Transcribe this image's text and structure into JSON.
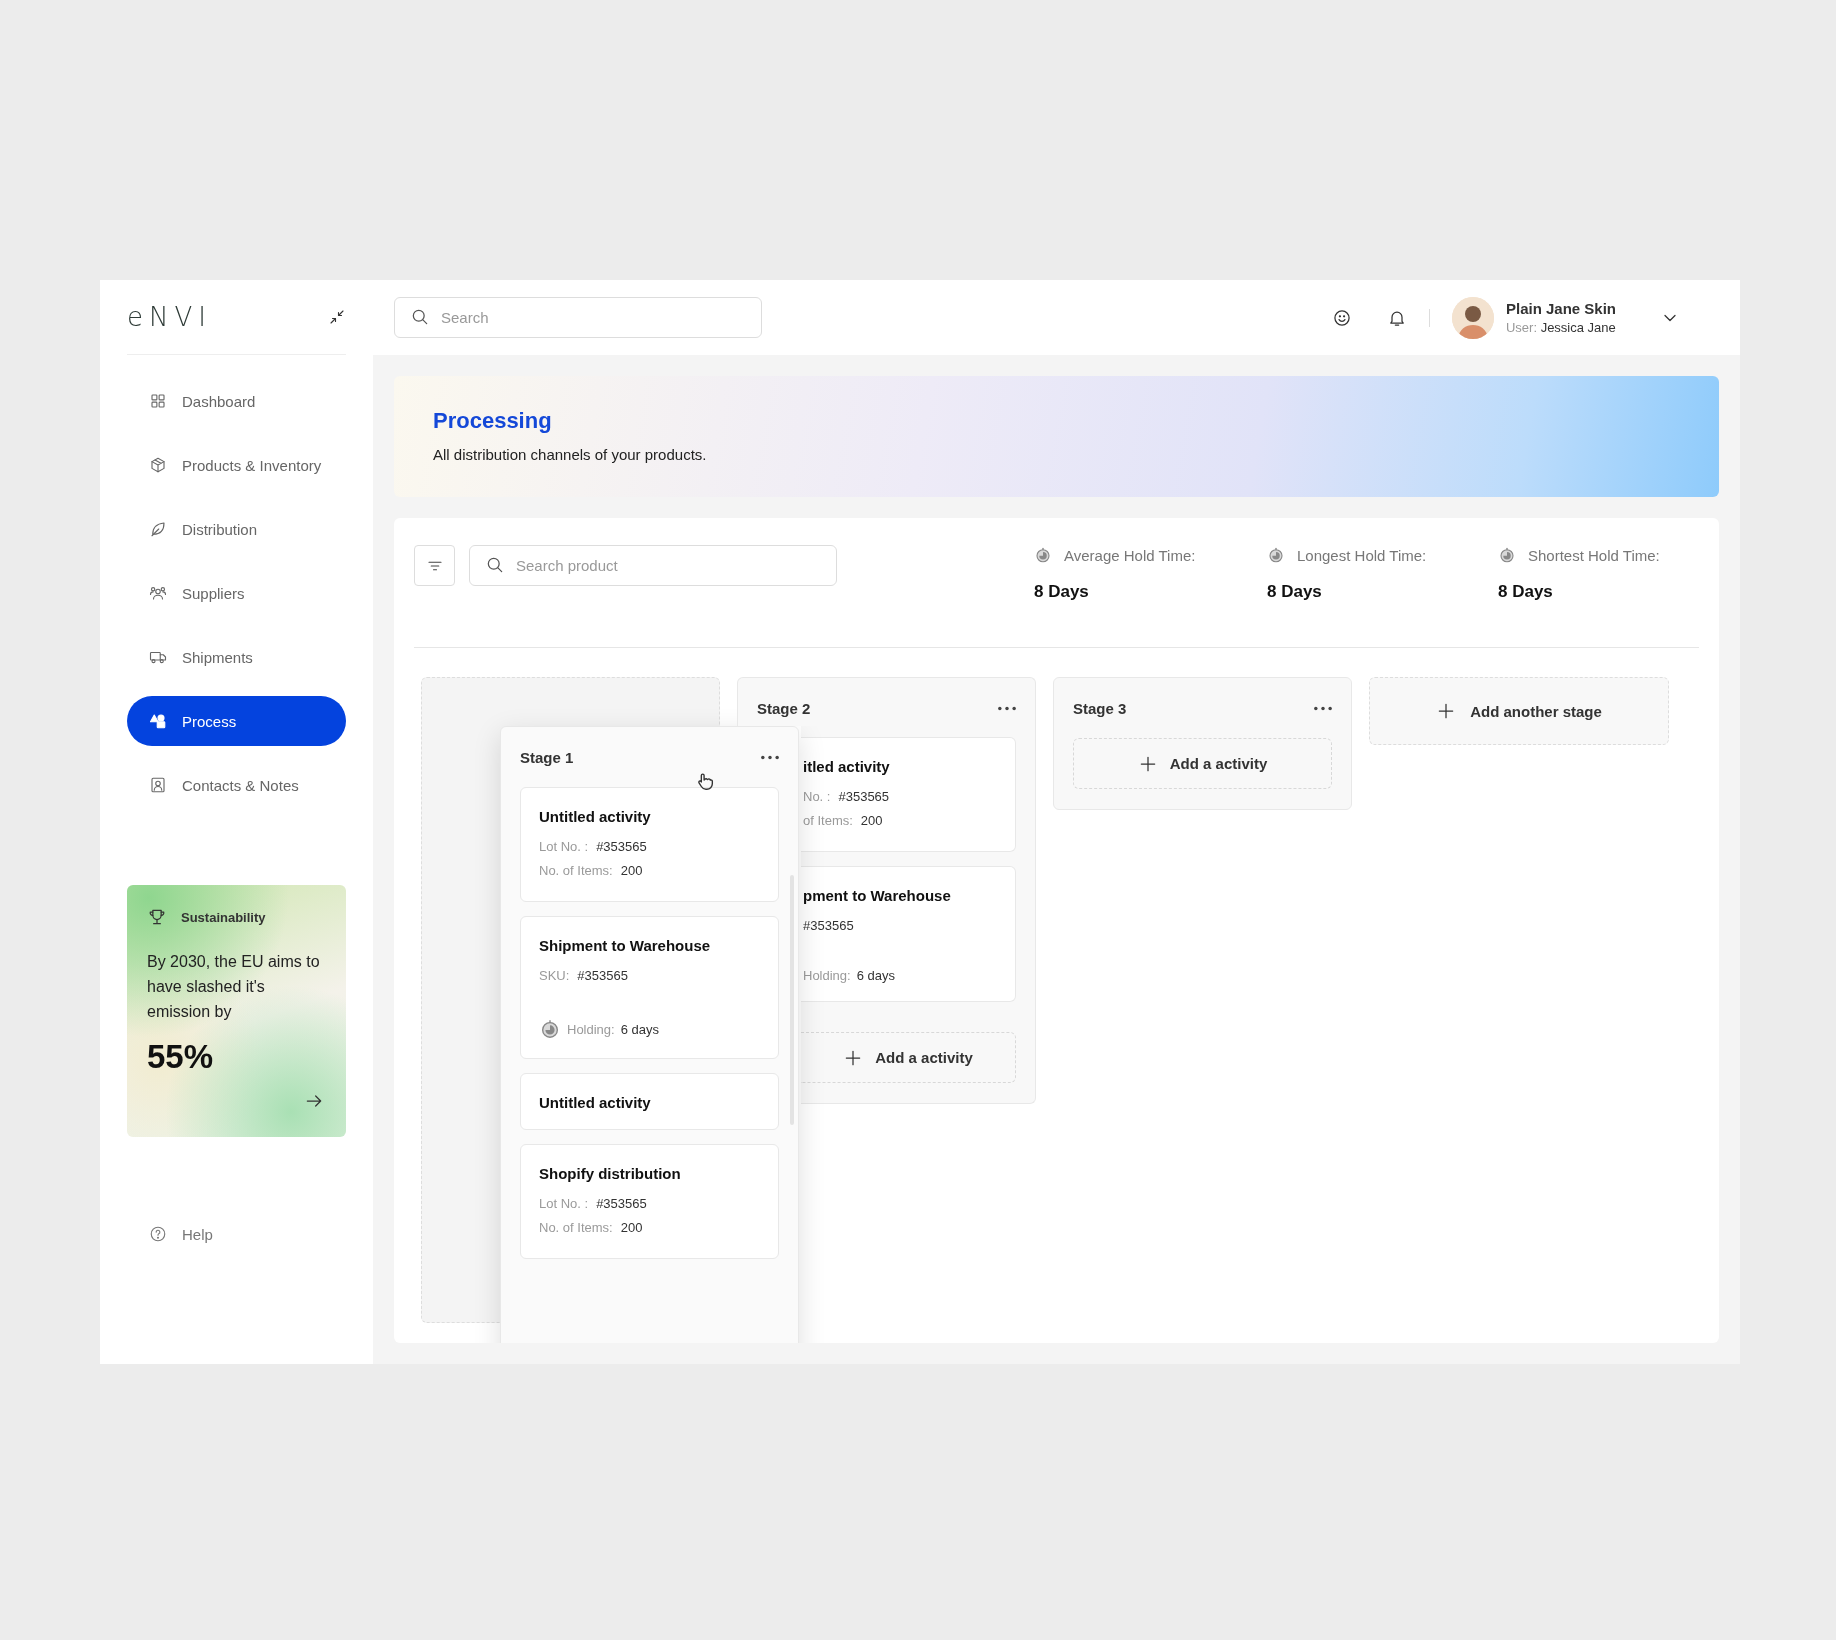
{
  "brand": {
    "logo": "eNVI"
  },
  "sidebar": {
    "items": [
      {
        "label": "Dashboard",
        "selected": false
      },
      {
        "label": "Products & Inventory",
        "selected": false
      },
      {
        "label": "Distribution",
        "selected": false
      },
      {
        "label": "Suppliers",
        "selected": false
      },
      {
        "label": "Shipments",
        "selected": false
      },
      {
        "label": "Process",
        "selected": true
      },
      {
        "label": "Contacts & Notes",
        "selected": false
      }
    ],
    "promo": {
      "title": "Sustainability",
      "text": "By 2030, the EU aims to have slashed it's emission by",
      "figure": "55%"
    },
    "help": "Help"
  },
  "header": {
    "search": {
      "placeholder": "Search"
    },
    "user": {
      "name": "Plain Jane Skin",
      "role_label": "User:",
      "role_value": "Jessica Jane"
    }
  },
  "banner": {
    "title": "Processing",
    "subtitle": "All distribution channels of your products."
  },
  "toolbar": {
    "search": {
      "placeholder": "Search product"
    },
    "stats": [
      {
        "label": "Average Hold Time:",
        "value": "8 Days"
      },
      {
        "label": "Longest Hold Time:",
        "value": "8 Days"
      },
      {
        "label": "Shortest Hold Time:",
        "value": "8 Days"
      }
    ]
  },
  "stages": [
    {
      "title": "Stage 1",
      "dragging": true,
      "cards": [
        {
          "title": "Untitled activity",
          "fields": [
            {
              "label": "Lot No. :",
              "value": "#353565"
            },
            {
              "label": "No. of Items:",
              "value": "200"
            }
          ]
        },
        {
          "title": "Shipment to Warehouse",
          "fields": [
            {
              "label": "SKU:",
              "value": "#353565"
            }
          ],
          "holding": {
            "label": "Holding:",
            "value": "6 days"
          }
        },
        {
          "title": "Untitled activity"
        },
        {
          "title": "Shopify distribution",
          "fields": [
            {
              "label": "Lot No. :",
              "value": "#353565"
            },
            {
              "label": "No. of Items:",
              "value": "200"
            }
          ]
        }
      ]
    },
    {
      "title": "Stage 2",
      "dragging": false,
      "covered": true,
      "cards": [
        {
          "title": "itled activity",
          "fields": [
            {
              "label": "No. :",
              "value": "#353565"
            },
            {
              "label": "of Items:",
              "value": "200"
            }
          ]
        },
        {
          "title": "pment to Warehouse",
          "fields": [
            {
              "value": "#353565"
            }
          ],
          "holding": {
            "label": "Holding:",
            "value": "6 days"
          }
        }
      ],
      "add_activity": "Add a activity"
    },
    {
      "title": "Stage 3",
      "dragging": false,
      "add_activity": "Add a activity"
    }
  ],
  "add_stage": "Add another stage"
}
